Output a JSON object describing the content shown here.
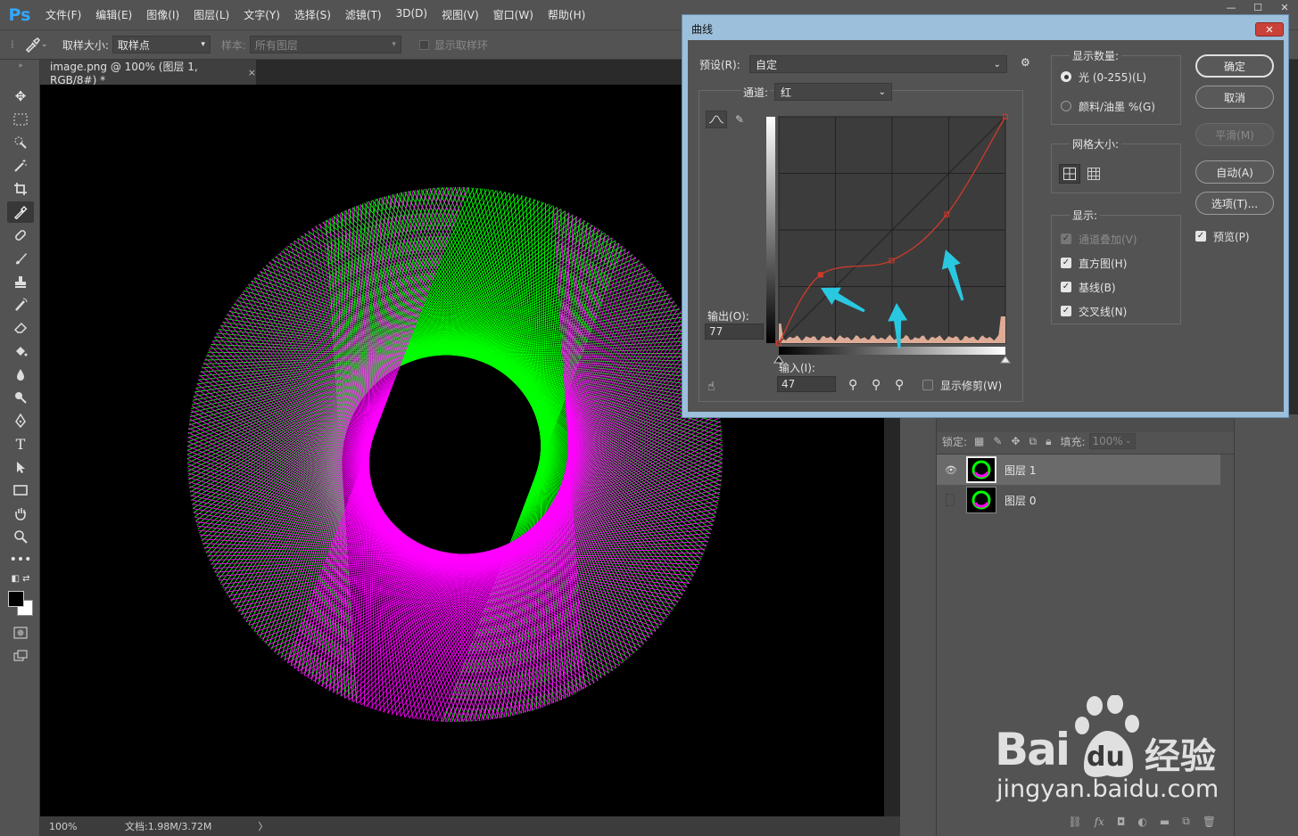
{
  "app": {
    "logo": "Ps"
  },
  "menu": [
    "文件(F)",
    "编辑(E)",
    "图像(I)",
    "图层(L)",
    "文字(Y)",
    "选择(S)",
    "滤镜(T)",
    "3D(D)",
    "视图(V)",
    "窗口(W)",
    "帮助(H)"
  ],
  "options": {
    "sample_size_label": "取样大小:",
    "sample_size_value": "取样点",
    "sample_label": "样本:",
    "sample_value": "所有图层",
    "show_ring_label": "显示取样环"
  },
  "document": {
    "tab_title": "image.png @ 100% (图层 1, RGB/8#) *",
    "close": "×"
  },
  "status": {
    "zoom": "100%",
    "doc_info": "文档:1.98M/3.72M",
    "arrow": "〉"
  },
  "layers": {
    "lock_label": "锁定:",
    "fill_label": "填充:",
    "fill_value": "100%",
    "items": [
      {
        "name": "图层 1",
        "visible": true,
        "selected": true
      },
      {
        "name": "图层 0",
        "visible": false,
        "selected": false
      }
    ]
  },
  "watermark": {
    "brand": "Bai",
    "brand2": "du",
    "cn": "经验",
    "url": "jingyan.baidu.com"
  },
  "curves": {
    "title": "曲线",
    "close": "✕",
    "preset_label": "预设(R):",
    "preset_value": "自定",
    "channel_label": "通道:",
    "channel_value": "红",
    "output_label": "输出(O):",
    "output_value": "77",
    "input_label": "输入(I):",
    "input_value": "47",
    "show_clipping": "显示修剪(W)",
    "show_amount_title": "显示数量:",
    "light_option": "光 (0-255)(L)",
    "pigment_option": "颜料/油墨 %(G)",
    "grid_size_title": "网格大小:",
    "display_title": "显示:",
    "display_options": [
      {
        "label": "通道叠加(V)",
        "checked": true,
        "disabled": true
      },
      {
        "label": "直方图(H)",
        "checked": true,
        "disabled": false
      },
      {
        "label": "基线(B)",
        "checked": true,
        "disabled": false
      },
      {
        "label": "交叉线(N)",
        "checked": true,
        "disabled": false
      }
    ],
    "buttons": {
      "ok": "确定",
      "cancel": "取消",
      "smooth": "平滑(M)",
      "auto": "自动(A)",
      "options": "选项(T)..."
    },
    "preview_label": "预览(P)",
    "curve_color": "#d03a2a",
    "arrow_color": "#29c8e0",
    "curve_points": [
      [
        0,
        0
      ],
      [
        47,
        77
      ],
      [
        127,
        93
      ],
      [
        189,
        145
      ],
      [
        255,
        255
      ]
    ]
  },
  "colors": {
    "green": "#00ff00",
    "magenta": "#ff00ff"
  }
}
